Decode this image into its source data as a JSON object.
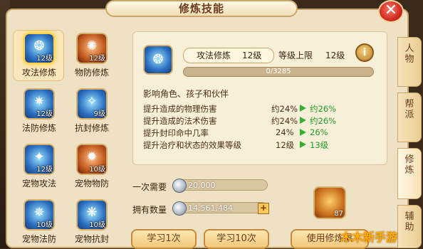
{
  "title": "修炼技能",
  "close_glyph": "✕",
  "skills": [
    {
      "name": "攻法修炼",
      "level": "12级",
      "icon": "attack-magic-icon",
      "selected": true
    },
    {
      "name": "物防修炼",
      "level": "12级",
      "icon": "physical-defense-icon"
    },
    {
      "name": "法防修炼",
      "level": "12级",
      "icon": "magic-defense-icon"
    },
    {
      "name": "抗封修炼",
      "level": "9级",
      "icon": "seal-resist-icon"
    },
    {
      "name": "宠物攻法",
      "level": "12级",
      "icon": "pet-attack-icon"
    },
    {
      "name": "宠物物防",
      "level": "10级",
      "icon": "pet-physical-defense-icon"
    },
    {
      "name": "宠物法防",
      "level": "10级",
      "icon": "pet-magic-defense-icon"
    },
    {
      "name": "宠物抗封",
      "level": "10级",
      "icon": "pet-seal-resist-icon"
    }
  ],
  "detail": {
    "skill_name": "攻法修炼",
    "skill_level": "12级",
    "max_label": "等级上限",
    "max_value": "12级",
    "progress_text": "0/3285",
    "progress_fraction": 0,
    "effects_heading": "影响角色、孩子和伙伴",
    "effects": [
      {
        "label": "提升造成的物理伤害",
        "current": "约24%",
        "next": "约26%"
      },
      {
        "label": "提升造成的法术伤害",
        "current": "约24%",
        "next": "约26%"
      },
      {
        "label": "提升封印命中几率",
        "current": "24%",
        "next": "26%"
      },
      {
        "label": "提升治疗和状态的效果等级",
        "current": "12级",
        "next": "13级"
      }
    ]
  },
  "cost": {
    "need_label": "一次需要",
    "need_value": "20,000",
    "own_label": "拥有数量",
    "own_value": "14,561,484",
    "plus": "+"
  },
  "buttons": {
    "learn1": "学习1次",
    "learn10": "学习10次",
    "use": "使用修炼果"
  },
  "item": {
    "count": "87",
    "icon": "cultivation-fruit-icon"
  },
  "side_tabs": [
    "人物",
    "帮派",
    "修炼",
    "辅助"
  ],
  "watermark": "木木新手游",
  "colors": {
    "accent": "#c9a66a",
    "green": "#1e9a2a",
    "close": "#c71f14"
  }
}
